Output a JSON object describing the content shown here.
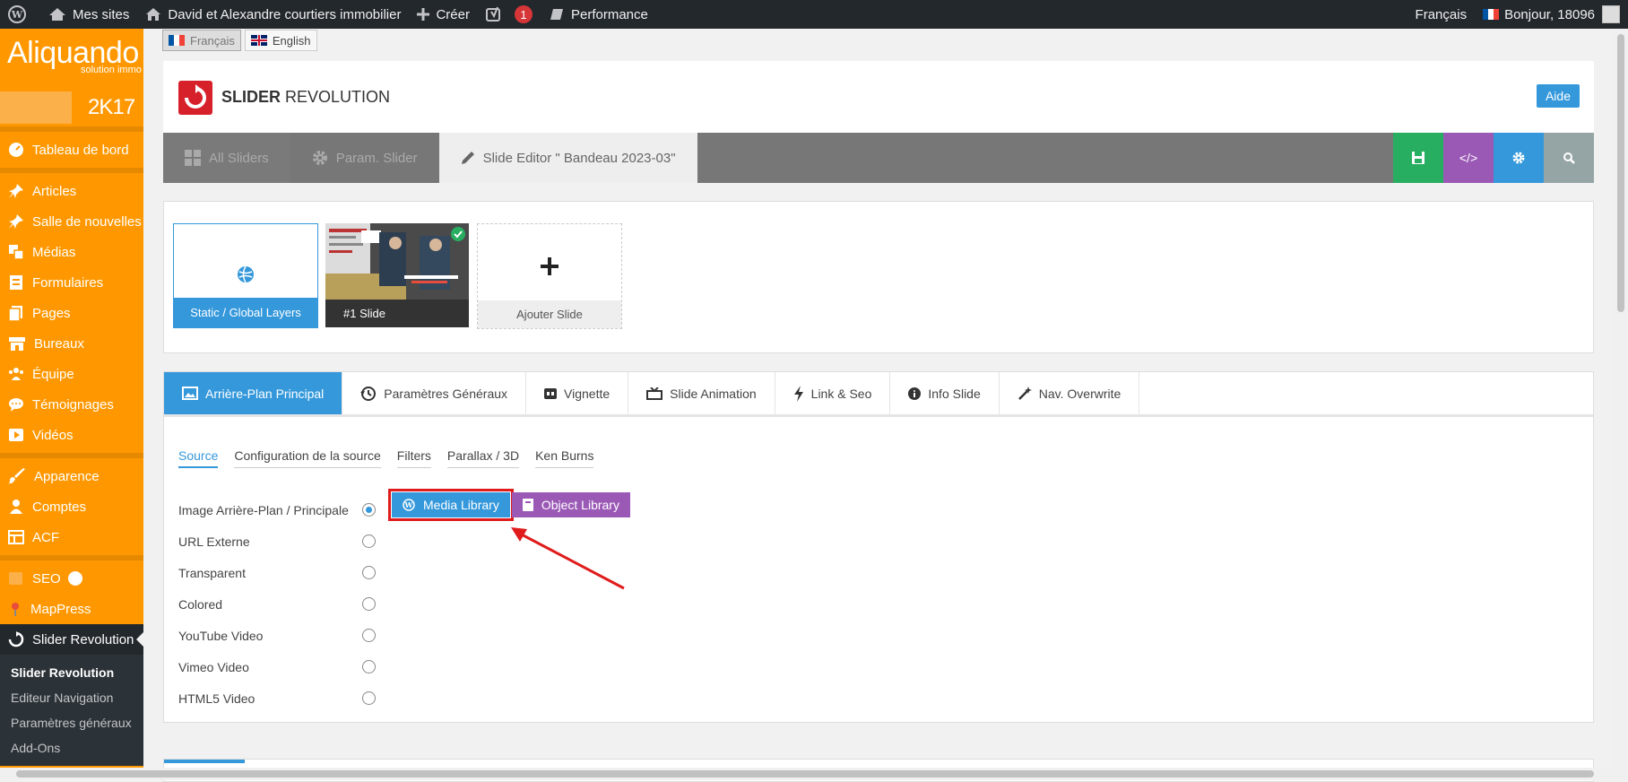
{
  "adminbar": {
    "my_sites": "Mes sites",
    "site_name": "David et Alexandre courtiers immobilier",
    "create": "Créer",
    "notif_count": "1",
    "performance": "Performance",
    "language": "Français",
    "greeting": "Bonjour, 18096"
  },
  "sidebar": {
    "logo_text": "Aliquando",
    "logo_sub": "solution immo",
    "year_label": "2K17",
    "items": [
      {
        "label": "Tableau de bord",
        "icon": "dashboard-icon"
      },
      {
        "label": "Articles",
        "icon": "pin-icon"
      },
      {
        "label": "Salle de nouvelles",
        "icon": "pin-icon"
      },
      {
        "label": "Médias",
        "icon": "media-icon"
      },
      {
        "label": "Formulaires",
        "icon": "forms-icon"
      },
      {
        "label": "Pages",
        "icon": "pages-icon"
      },
      {
        "label": "Bureaux",
        "icon": "store-icon"
      },
      {
        "label": "Équipe",
        "icon": "team-icon"
      },
      {
        "label": "Témoignages",
        "icon": "comment-icon"
      },
      {
        "label": "Vidéos",
        "icon": "video-icon"
      },
      {
        "label": "Apparence",
        "icon": "brush-icon"
      },
      {
        "label": "Comptes",
        "icon": "user-icon"
      },
      {
        "label": "ACF",
        "icon": "table-icon"
      },
      {
        "label": "SEO",
        "icon": "seo-icon"
      },
      {
        "label": "MapPress",
        "icon": "map-pin-icon"
      },
      {
        "label": "Slider Revolution",
        "icon": "refresh-icon"
      }
    ],
    "submenu": [
      "Slider Revolution",
      "Editeur Navigation",
      "Paramètres généraux",
      "Add-Ons"
    ]
  },
  "lang_switch": {
    "fr": "Français",
    "en": "English"
  },
  "header": {
    "title_bold": "SLIDER",
    "title_light": " REVOLUTION",
    "help": "Aide"
  },
  "nav": {
    "all_sliders": "All Sliders",
    "slider_settings": "Param. Slider",
    "slide_editor": "Slide Editor \" Bandeau 2023-03\"",
    "code_label": "</>"
  },
  "slides": {
    "static": "Static / Global Layers",
    "slide1": "#1 Slide",
    "add": "Ajouter Slide"
  },
  "settings": {
    "tabs": [
      "Arrière-Plan Principal",
      "Paramètres Généraux",
      "Vignette",
      "Slide Animation",
      "Link & Seo",
      "Info Slide",
      "Nav. Overwrite"
    ],
    "subtabs": [
      "Source",
      "Configuration de la source",
      "Filters",
      "Parallax / 3D",
      "Ken Burns"
    ],
    "sources": [
      "Image Arrière-Plan / Principale",
      "URL Externe",
      "Transparent",
      "Colored",
      "YouTube Video",
      "Vimeo Video",
      "HTML5 Video"
    ],
    "selected_source": 0,
    "media_library": "Media Library",
    "object_library": "Object Library"
  },
  "colors": {
    "sidebar": "#ff9800",
    "accent": "#3498db",
    "purple": "#9b59b6",
    "save": "#27ae60",
    "highlight": "#e01b1b"
  }
}
